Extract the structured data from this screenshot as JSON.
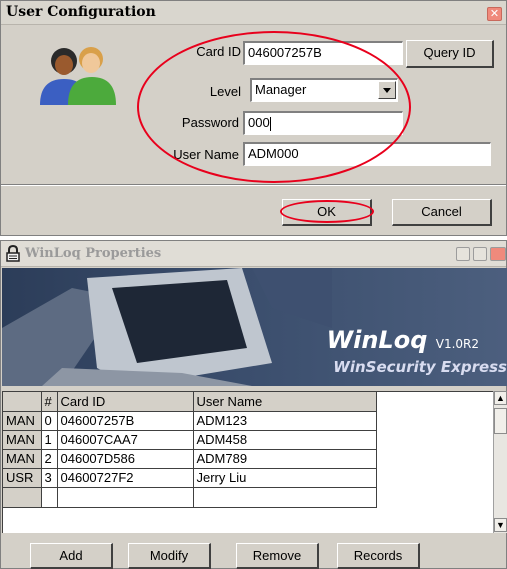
{
  "config_dialog": {
    "title": "User Configuration",
    "close_icon": "close-icon",
    "card_id_label": "Card ID",
    "card_id_value": "046007257B",
    "query_button": "Query ID",
    "level_label": "Level",
    "level_value": "Manager",
    "password_label": "Password",
    "password_value": "000",
    "username_label": "User Name",
    "username_value": "ADM000",
    "ok_button": "OK",
    "cancel_button": "Cancel",
    "highlight_color": "#e8001c"
  },
  "winloq": {
    "title": "WinLoq Properties",
    "banner_title": "WinLoq",
    "banner_version": "V1.0R2",
    "banner_subtitle": "WinSecurity Express",
    "columns": [
      "",
      "#",
      "Card ID",
      "User Name"
    ],
    "rows": [
      {
        "level": "MAN",
        "num": "0",
        "card": "046007257B",
        "name": "ADM123"
      },
      {
        "level": "MAN",
        "num": "1",
        "card": "046007CAA7",
        "name": "ADM458"
      },
      {
        "level": "MAN",
        "num": "2",
        "card": "046007D586",
        "name": "ADM789"
      },
      {
        "level": "USR",
        "num": "3",
        "card": "04600727F2",
        "name": "Jerry Liu"
      }
    ],
    "buttons": {
      "add": "Add",
      "modify": "Modify",
      "remove": "Remove",
      "records": "Records"
    }
  }
}
